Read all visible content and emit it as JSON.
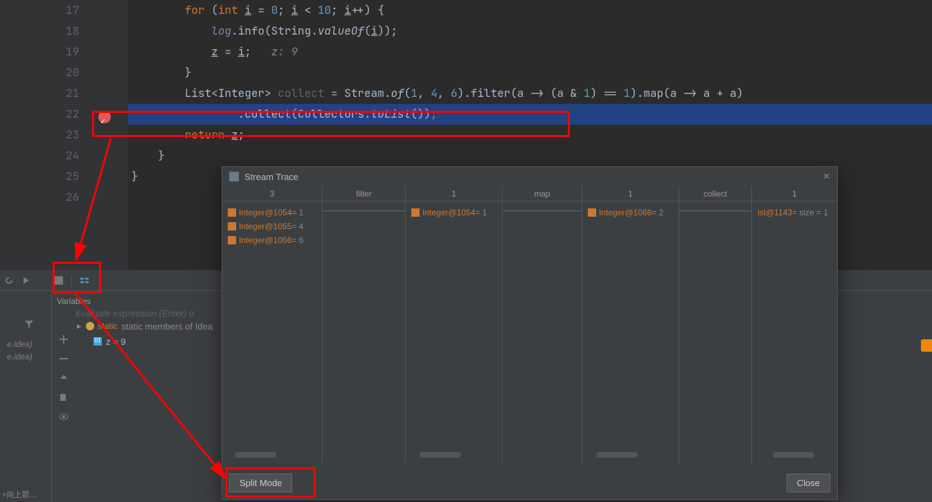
{
  "editor": {
    "lines": [
      {
        "n": 17,
        "code": "        for (int i = 0; i < 10; i++) {"
      },
      {
        "n": 18,
        "code": "            log.info(String.valueOf(i));"
      },
      {
        "n": 19,
        "code": "            z = i;   z: 9"
      },
      {
        "n": 20,
        "code": "        }"
      },
      {
        "n": 21,
        "code": "        List<Integer> collect = Stream.of(1, 4, 6).filter(a -> (a & 1) == 1).map(a -> a + a)"
      },
      {
        "n": 22,
        "code": "                .collect(Collectors.toList());"
      },
      {
        "n": 23,
        "code": "        return z;"
      },
      {
        "n": 24,
        "code": "    }"
      },
      {
        "n": 25,
        "code": "}"
      },
      {
        "n": 26,
        "code": ""
      }
    ]
  },
  "debug": {
    "variables_label": "Variables",
    "eval_placeholder": "Evaluate expression (Enter) o",
    "static_label": "static members of Idea",
    "z_label": "z = 9",
    "file1": "e.idea)",
    "file2": "e.idea)"
  },
  "dialog": {
    "title": "Stream Trace",
    "stages": {
      "s0_count": "3",
      "s1_label": "filter",
      "s2_count": "1",
      "s3_label": "map",
      "s4_count": "1",
      "s5_label": "collect",
      "s6_count": "1"
    },
    "data0": [
      {
        "name": "Integer@1054",
        "val": " = 1"
      },
      {
        "name": "Integer@1055",
        "val": " = 4"
      },
      {
        "name": "Integer@1056",
        "val": " = 6"
      }
    ],
    "data2": [
      {
        "name": "Integer@1054",
        "val": " = 1"
      }
    ],
    "data4": [
      {
        "name": "Integer@1066",
        "val": " = 2"
      }
    ],
    "data6": [
      {
        "name": "ist@1143",
        "val": " =  size = 1"
      }
    ],
    "split_mode": "Split Mode",
    "close": "Close"
  },
  "bottom": "+向上箭…"
}
